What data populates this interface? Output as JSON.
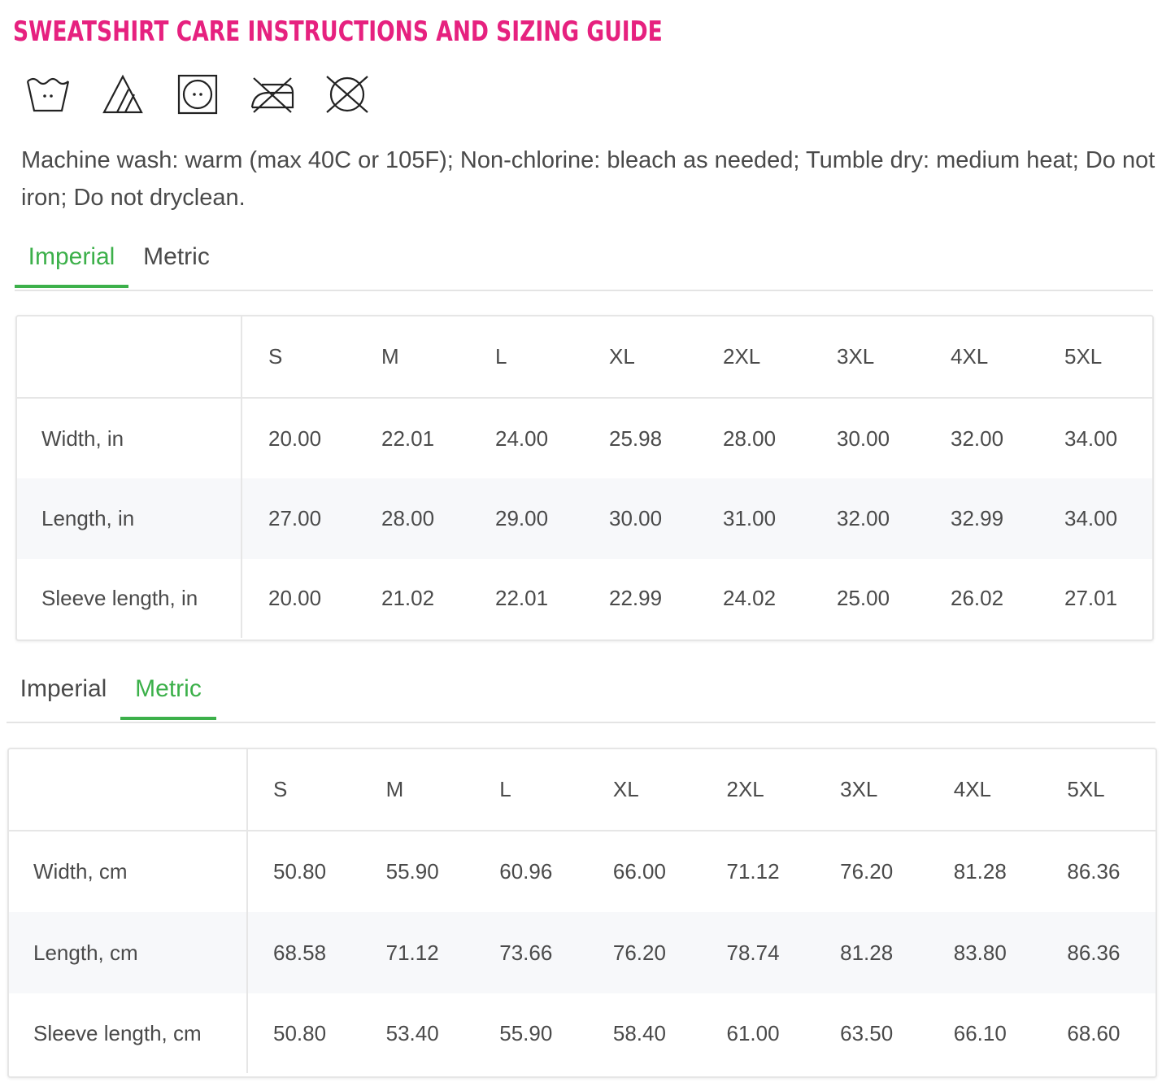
{
  "title": "SWEATSHIRT CARE INSTRUCTIONS AND SIZING GUIDE",
  "accent_color": "#e6217f",
  "tab_active_color": "#3cb04a",
  "care_icons": [
    "machine-wash-warm-icon",
    "non-chlorine-bleach-icon",
    "tumble-dry-medium-icon",
    "do-not-iron-icon",
    "do-not-dryclean-icon"
  ],
  "care_text": "Machine wash: warm (max 40C or 105F); Non-chlorine: bleach as needed; Tumble dry: medium heat; Do not iron; Do not dryclean.",
  "sections": [
    {
      "tabs": [
        "Imperial",
        "Metric"
      ],
      "active_tab": "Imperial",
      "sizes": [
        "S",
        "M",
        "L",
        "XL",
        "2XL",
        "3XL",
        "4XL",
        "5XL"
      ],
      "rows": [
        {
          "label": "Width, in",
          "values": [
            "20.00",
            "22.01",
            "24.00",
            "25.98",
            "28.00",
            "30.00",
            "32.00",
            "34.00"
          ]
        },
        {
          "label": "Length, in",
          "values": [
            "27.00",
            "28.00",
            "29.00",
            "30.00",
            "31.00",
            "32.00",
            "32.99",
            "34.00"
          ]
        },
        {
          "label": "Sleeve length, in",
          "values": [
            "20.00",
            "21.02",
            "22.01",
            "22.99",
            "24.02",
            "25.00",
            "26.02",
            "27.01"
          ]
        }
      ]
    },
    {
      "tabs": [
        "Imperial",
        "Metric"
      ],
      "active_tab": "Metric",
      "sizes": [
        "S",
        "M",
        "L",
        "XL",
        "2XL",
        "3XL",
        "4XL",
        "5XL"
      ],
      "rows": [
        {
          "label": "Width, cm",
          "values": [
            "50.80",
            "55.90",
            "60.96",
            "66.00",
            "71.12",
            "76.20",
            "81.28",
            "86.36"
          ]
        },
        {
          "label": "Length, cm",
          "values": [
            "68.58",
            "71.12",
            "73.66",
            "76.20",
            "78.74",
            "81.28",
            "83.80",
            "86.36"
          ]
        },
        {
          "label": "Sleeve length, cm",
          "values": [
            "50.80",
            "53.40",
            "55.90",
            "58.40",
            "61.00",
            "63.50",
            "66.10",
            "68.60"
          ]
        }
      ]
    }
  ]
}
